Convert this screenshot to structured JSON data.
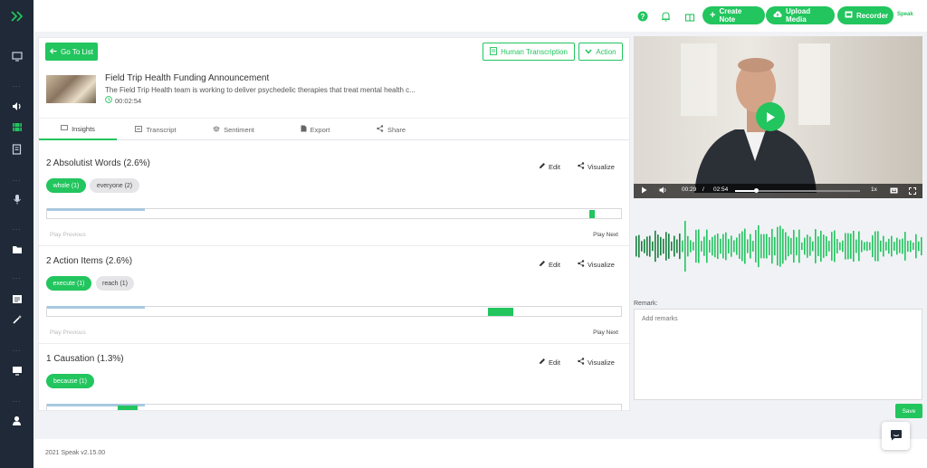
{
  "topbar": {
    "create_note": "Create Note",
    "upload_media": "Upload Media",
    "recorder": "Recorder",
    "brand": "Speak"
  },
  "header": {
    "go_to_list": "Go To List",
    "human_transcription": "Human Transcription",
    "action": "Action"
  },
  "media": {
    "title": "Field Trip Health Funding Announcement",
    "description": "The Field Trip Health team is working to deliver psychedelic therapies that treat mental health c...",
    "duration": "00:02:54"
  },
  "tabs": [
    {
      "label": "Insights",
      "icon": "insights-icon"
    },
    {
      "label": "Transcript",
      "icon": "transcript-icon"
    },
    {
      "label": "Sentiment",
      "icon": "sentiment-icon"
    },
    {
      "label": "Export",
      "icon": "export-icon"
    },
    {
      "label": "Share",
      "icon": "share-icon"
    }
  ],
  "sections": [
    {
      "title": "2 Absolutist Words (2.6%)",
      "chips": [
        {
          "label": "whole (1)",
          "active": true
        },
        {
          "label": "everyone (2)",
          "active": false
        }
      ],
      "progress": 0.17,
      "marker": 0.95,
      "play_previous": "Play Previous",
      "play_next": "Play Next"
    },
    {
      "title": "2 Action Items (2.6%)",
      "chips": [
        {
          "label": "execute (1)",
          "active": true
        },
        {
          "label": "reach (1)",
          "active": false
        }
      ],
      "progress": 0.17,
      "marker": 0.79,
      "play_previous": "Play Previous",
      "play_next": "Play Next"
    },
    {
      "title": "1 Causation (1.3%)",
      "chips": [
        {
          "label": "because (1)",
          "active": true
        }
      ],
      "progress": 0.17,
      "marker": 0.14
    }
  ],
  "actions": {
    "edit": "Edit",
    "visualize": "Visualize"
  },
  "video": {
    "current_time": "00:29",
    "separator": "/",
    "total_time": "02:54",
    "speed": "1x",
    "position": 0.17
  },
  "remark": {
    "label": "Remark:",
    "placeholder": "Add remarks",
    "save": "Save"
  },
  "footer": {
    "version": "2021 Speak v2.15.00"
  },
  "colors": {
    "accent": "#22c55e",
    "sidebar": "#1f2937"
  }
}
